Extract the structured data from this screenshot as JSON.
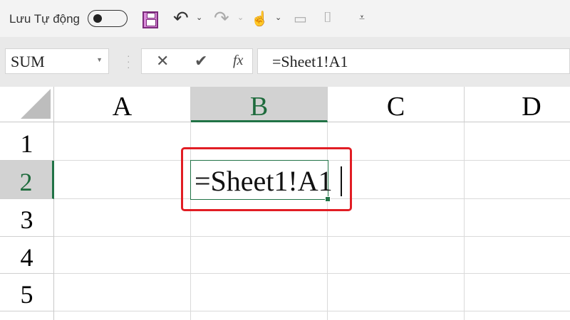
{
  "qat": {
    "autosave_label": "Lưu Tự động",
    "autosave_on": false
  },
  "namebox": {
    "value": "SUM"
  },
  "formula": {
    "cancel": "✕",
    "enter": "✔",
    "fx": "fx",
    "value": "=Sheet1!A1"
  },
  "columns": [
    "A",
    "B",
    "C",
    "D"
  ],
  "rows": [
    "1",
    "2",
    "3",
    "4",
    "5"
  ],
  "active_cell": {
    "ref": "B2",
    "edit_text": "=Sheet1!A1"
  },
  "colors": {
    "accent": "#217346",
    "highlight": "#e11d24"
  }
}
